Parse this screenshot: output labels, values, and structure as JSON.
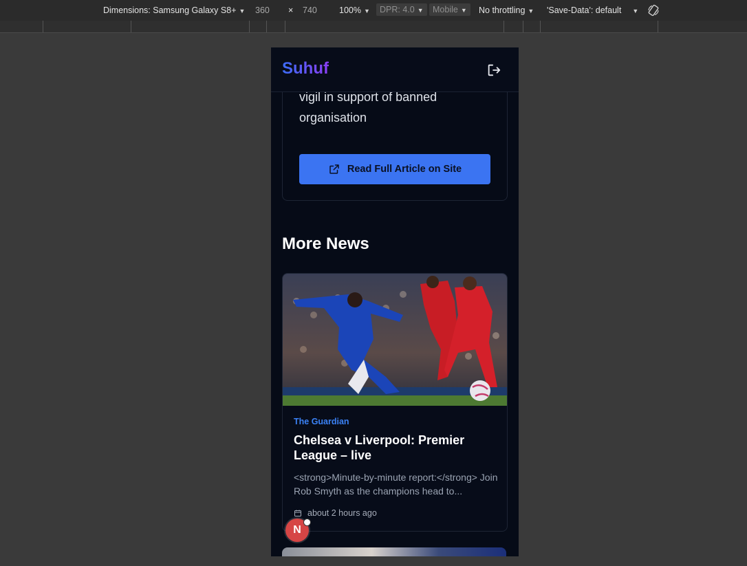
{
  "devtools": {
    "dimensions_label": "Dimensions: Samsung Galaxy S8+",
    "width": "360",
    "times": "×",
    "height": "740",
    "zoom": "100%",
    "dpr": "DPR: 4.0",
    "mode": "Mobile",
    "throttling": "No throttling",
    "save_data": "'Save-Data': default"
  },
  "app": {
    "brand": "Suhuf",
    "article_title_tail": "vigil in support of banned organisation",
    "read_button": "Read Full Article on Site",
    "section_title": "More News"
  },
  "news": [
    {
      "source": "The Guardian",
      "title": "Chelsea v Liverpool: Premier League – live",
      "snippet": "<strong>Minute-by-minute report:</strong> Join Rob Smyth as the champions head to...",
      "time": "about 2 hours ago"
    }
  ],
  "badge": {
    "letter": "N"
  },
  "colors": {
    "accent": "#3b74f2",
    "brand_start": "#3b6cf6",
    "brand_end": "#8b3ef5",
    "source": "#3b82f6"
  }
}
